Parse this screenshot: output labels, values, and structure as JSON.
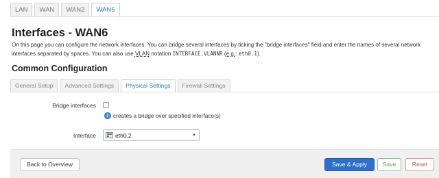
{
  "top_tabs": [
    "LAN",
    "WAN",
    "WAN2",
    "WAN6"
  ],
  "active_top_tab": "WAN6",
  "page_title": "Interfaces - WAN6",
  "description": {
    "part1": "On this page you can configure the network interfaces. You can bridge several interfaces by ticking the \"bridge interfaces\" field and enter the names of several network interfaces separated by spaces. You can also use ",
    "abbr": "VLAN",
    "part2": " notation ",
    "code1": "INTERFACE.VLANNR",
    "part3": " (",
    "eg": "e.g.",
    "part4": ": ",
    "code2": "eth0.1",
    "part5": ")."
  },
  "section_title": "Common Configuration",
  "section_tabs": [
    "General Setup",
    "Advanced Settings",
    "Physical Settings",
    "Firewall Settings"
  ],
  "active_section_tab": "Physical Settings",
  "bridge": {
    "label": "Bridge interfaces",
    "checked": false,
    "hint": "creates a bridge over specified interface(s)",
    "info_icon": "info-icon"
  },
  "interface": {
    "label": "Interface",
    "value": "eth0.2",
    "icon": "ethernet-port-icon"
  },
  "footer": {
    "back_label": "Back to Overview",
    "apply_label": "Save & Apply",
    "save_label": "Save",
    "reset_label": "Reset"
  },
  "colors": {
    "active_tab": "#2a7ab8",
    "apply_button": "#2f6fcc",
    "save_text": "#5aa05a",
    "reset_text": "#c05050"
  }
}
